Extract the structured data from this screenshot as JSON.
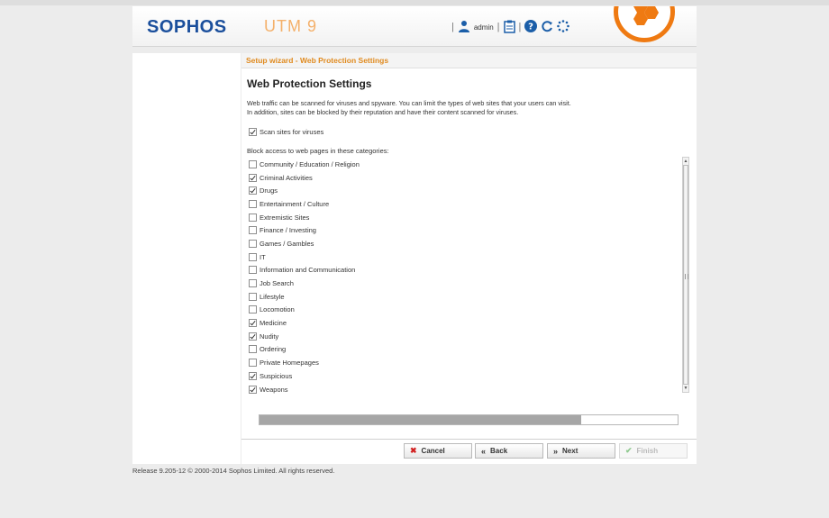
{
  "header": {
    "logo": "SOPHOS",
    "product": "UTM 9",
    "user": "admin",
    "separator": "|",
    "icons": [
      "user-icon",
      "clipboard-icon",
      "help-icon",
      "refresh-icon",
      "spinner-icon"
    ]
  },
  "panel": {
    "title": "Setup wizard - Web Protection Settings",
    "heading": "Web Protection Settings",
    "description_line1": "Web traffic can be scanned for viruses and spyware. You can limit the types of web sites that your users can visit.",
    "description_line2": "In addition, sites can be blocked by their reputation and have their content scanned for viruses.",
    "scan_label": "Scan sites for viruses",
    "scan_checked": true,
    "block_label": "Block access to web pages in these categories:",
    "categories": [
      {
        "label": "Community / Education / Religion",
        "checked": false
      },
      {
        "label": "Criminal Activities",
        "checked": true
      },
      {
        "label": "Drugs",
        "checked": true
      },
      {
        "label": "Entertainment / Culture",
        "checked": false
      },
      {
        "label": "Extremistic Sites",
        "checked": false
      },
      {
        "label": "Finance / Investing",
        "checked": false
      },
      {
        "label": "Games / Gambles",
        "checked": false
      },
      {
        "label": "IT",
        "checked": false
      },
      {
        "label": "Information and Communication",
        "checked": false
      },
      {
        "label": "Job Search",
        "checked": false
      },
      {
        "label": "Lifestyle",
        "checked": false
      },
      {
        "label": "Locomotion",
        "checked": false
      },
      {
        "label": "Medicine",
        "checked": true
      },
      {
        "label": "Nudity",
        "checked": true
      },
      {
        "label": "Ordering",
        "checked": false
      },
      {
        "label": "Private Homepages",
        "checked": false
      },
      {
        "label": "Suspicious",
        "checked": true
      },
      {
        "label": "Weapons",
        "checked": true
      }
    ],
    "progress_fraction": 0.77
  },
  "buttons": {
    "cancel": "Cancel",
    "back": "Back",
    "next": "Next",
    "finish": "Finish"
  },
  "footer": "Release 9.205-12  © 2000-2014 Sophos Limited. All rights reserved.",
  "colors": {
    "brand_blue": "#1b4f9c",
    "accent_orange": "#ef7a12",
    "title_orange": "#e08a1e",
    "cancel_red": "#d22020",
    "finish_green": "#8fc98f"
  }
}
